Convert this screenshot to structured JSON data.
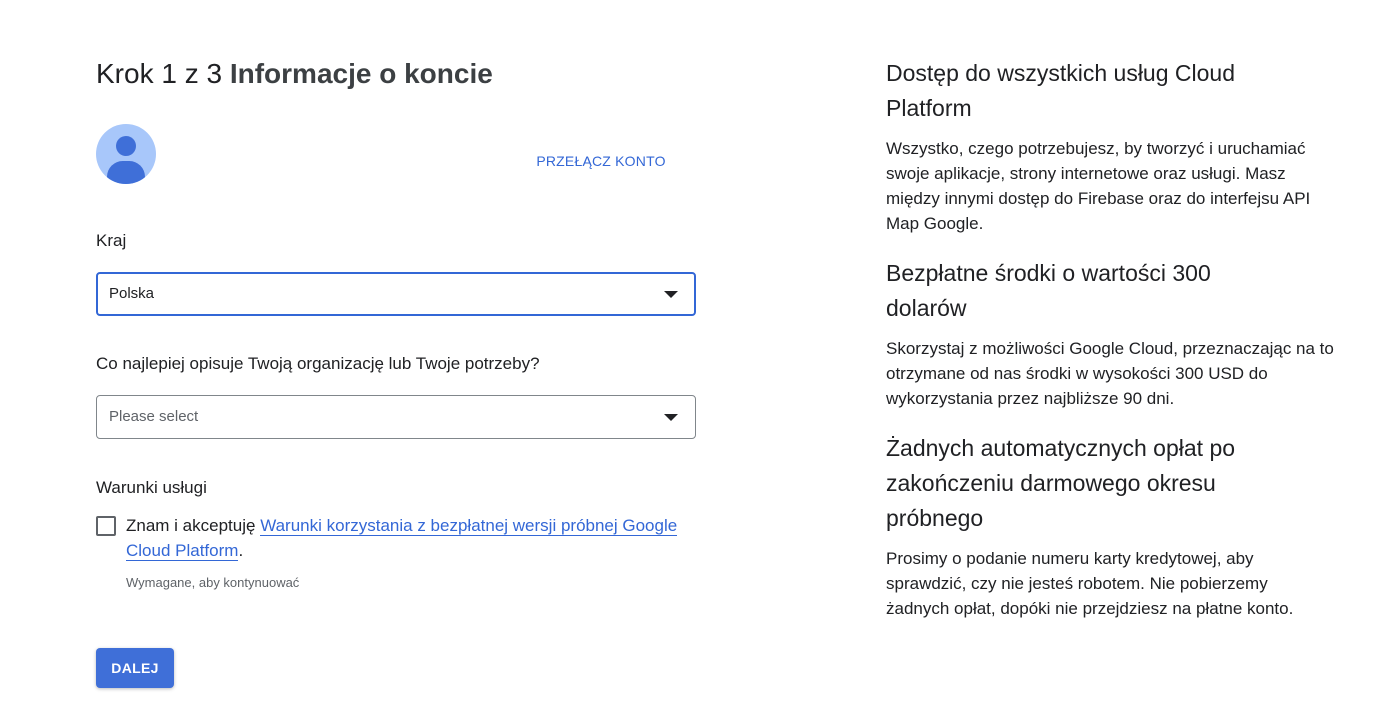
{
  "header": {
    "step_label": "Krok 1 z 3",
    "step_title": "Informacje o koncie"
  },
  "account": {
    "switch_label": "PRZEŁĄCZ KONTO"
  },
  "country": {
    "label": "Kraj",
    "value": "Polska"
  },
  "organization": {
    "label": "Co najlepiej opisuje Twoją organizację lub Twoje potrzeby?",
    "placeholder": "Please select"
  },
  "terms": {
    "label": "Warunki usługi",
    "text_before": "Znam i akceptuję ",
    "link": "Warunki korzystania z bezpłatnej wersji próbnej Google Cloud Platform",
    "text_after": ".",
    "helper": "Wymagane, aby kontynuować",
    "checked": false
  },
  "actions": {
    "next_label": "DALEJ"
  },
  "info": [
    {
      "title": "Dostęp do wszystkich usług Cloud Platform",
      "text": "Wszystko, czego potrzebujesz, by tworzyć i uruchamiać swoje aplikacje, strony internetowe oraz usługi. Masz między innymi dostęp do Firebase oraz do interfejsu API Map Google."
    },
    {
      "title": "Bezpłatne środki o wartości 300 dolarów",
      "text": "Skorzystaj z możliwości Google Cloud, przeznaczając na to otrzymane od nas środki w wysokości 300 USD do wykorzystania przez najbliższe 90 dni."
    },
    {
      "title": "Żadnych automatycznych opłat po zakończeniu darmowego okresu próbnego",
      "text": "Prosimy o podanie numeru karty kredytowej, aby sprawdzić, czy nie jesteś robotem. Nie pobierzemy żadnych opłat, dopóki nie przejdziesz na płatne konto."
    }
  ],
  "colors": {
    "accent": "#3367d6",
    "button": "#3f6fd8",
    "avatar_bg": "#a8c7fa"
  }
}
